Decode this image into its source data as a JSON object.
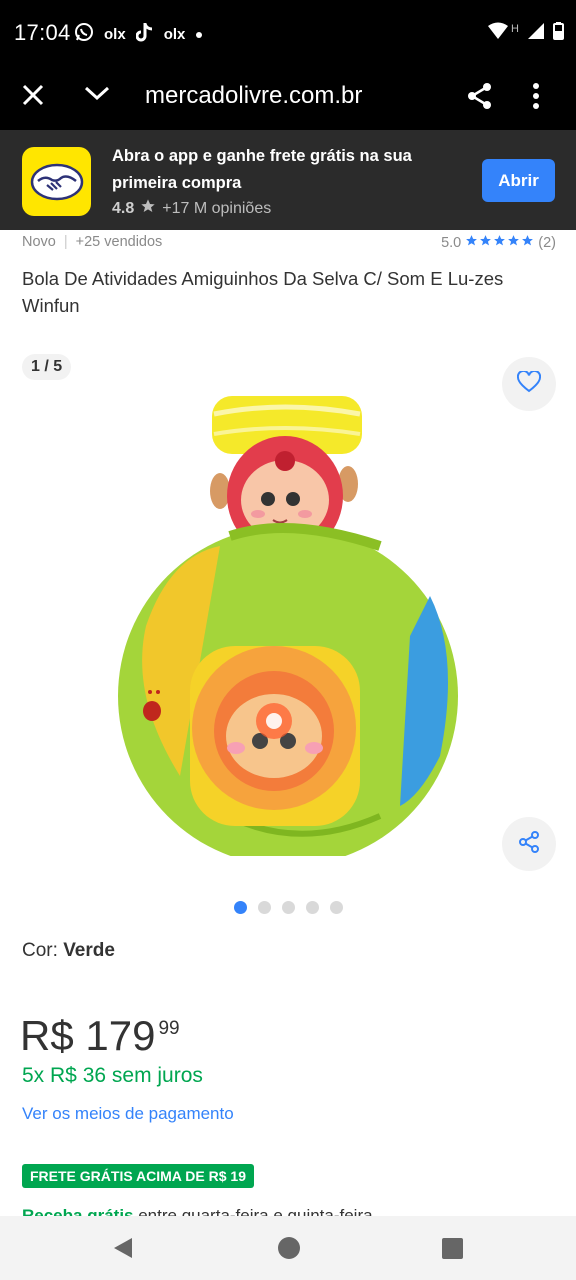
{
  "status_bar": {
    "time": "17:04",
    "notif_1": "olx",
    "notif_2": "olx",
    "network_label": "H"
  },
  "browser": {
    "url": "mercadolivre.com.br"
  },
  "app_banner": {
    "text": "Abra o app e ganhe frete grátis na sua primeira compra",
    "rating": "4.8",
    "reviews": "+17 M opiniões",
    "button_label": "Abrir"
  },
  "product": {
    "condition": "Novo",
    "sold": "+25 vendidos",
    "rating": "5.0",
    "review_count": "(2)",
    "stars_filled": 5,
    "title": "Bola De Atividades Amiguinhos Da Selva C/ Som E Lu-zes Winfun"
  },
  "gallery": {
    "counter": "1 / 5",
    "total_images": 5,
    "active_index": 0
  },
  "color": {
    "label": "Cor:",
    "value": "Verde"
  },
  "pricing": {
    "price": "R$ 179",
    "cents": "99",
    "installments": "5x R$ 36 sem juros",
    "payment_link": "Ver os meios de pagamento",
    "shipping_badge": "FRETE GRÁTIS ACIMA DE R$ 19",
    "delivery_highlight": "Receba grátis",
    "delivery_rest": " entre quarta-feira e quinta-feira"
  },
  "colors": {
    "brand_yellow": "#ffe600",
    "accent_blue": "#3483fa",
    "success_green": "#00a650"
  }
}
